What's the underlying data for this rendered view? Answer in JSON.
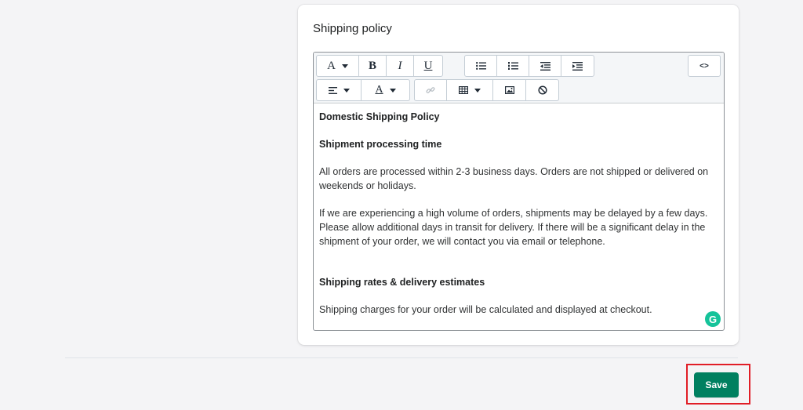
{
  "card": {
    "title": "Shipping policy"
  },
  "toolbar": {
    "font_label": "A",
    "bold_label": "B",
    "italic_label": "I",
    "underline_label": "U",
    "html_label": "<>",
    "text_color_label": "A"
  },
  "content": {
    "heading1": "Domestic Shipping Policy",
    "heading2": "Shipment processing time",
    "para1": "All orders are processed within 2-3 business days. Orders are not shipped or delivered on weekends or holidays.",
    "para2": "If we are experiencing a high volume of orders, shipments may be delayed by a few days. Please allow additional days in transit for delivery. If there will be a significant delay in the shipment of your order, we will contact you via email or telephone.",
    "heading3": "Shipping rates & delivery estimates",
    "para3": "Shipping charges for your order will be calculated and displayed at checkout."
  },
  "grammarly_label": "G",
  "footer": {
    "save_label": "Save"
  },
  "colors": {
    "primary": "#008060",
    "highlight": "#e11d26",
    "grammarly": "#15c39a"
  }
}
